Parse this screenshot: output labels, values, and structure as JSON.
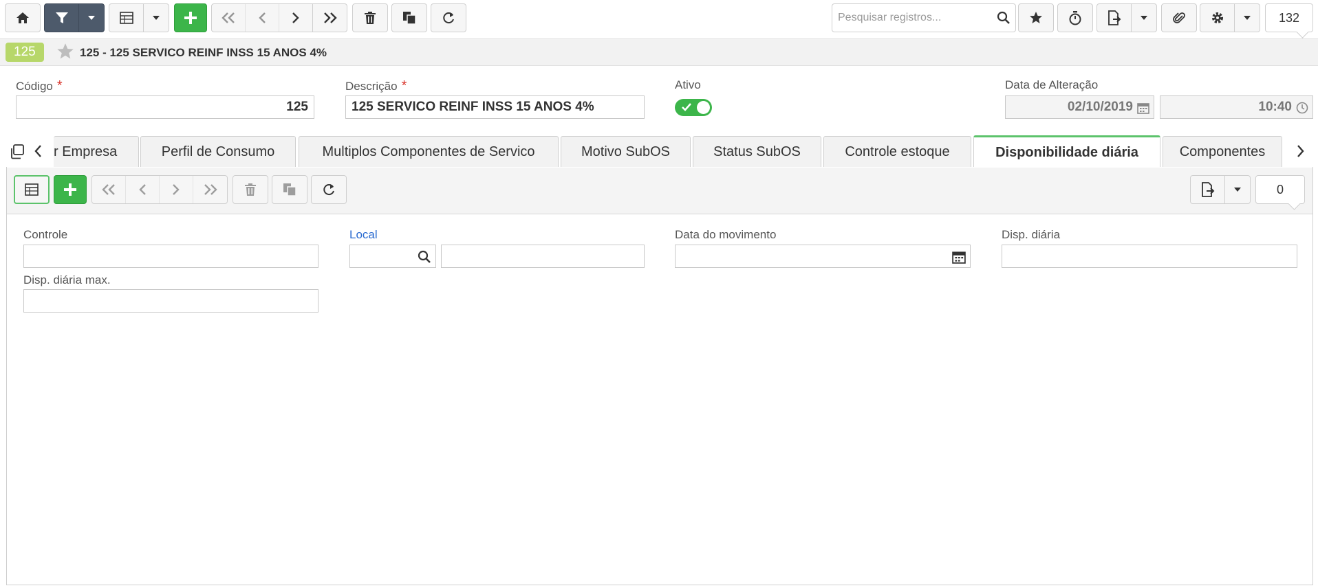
{
  "toolbar": {
    "search_placeholder": "Pesquisar registros...",
    "record_count": "132"
  },
  "record": {
    "badge": "125",
    "title": "125 - 125 SERVICO REINF INSS 15 ANOS 4%"
  },
  "form": {
    "codigo_label": "Código",
    "codigo_value": "125",
    "descricao_label": "Descrição",
    "descricao_value": "125 SERVICO REINF INSS 15 ANOS 4%",
    "ativo_label": "Ativo",
    "ativo_on": true,
    "data_alteracao_label": "Data de Alteração",
    "data_alteracao_date": "02/10/2019",
    "data_alteracao_time": "10:40",
    "required_mark": "*"
  },
  "tabs": [
    {
      "label": "r Empresa"
    },
    {
      "label": "Perfil de Consumo"
    },
    {
      "label": "Multiplos Componentes de Servico"
    },
    {
      "label": "Motivo SubOS"
    },
    {
      "label": "Status SubOS"
    },
    {
      "label": "Controle estoque"
    },
    {
      "label": "Disponibilidade diária",
      "active": true
    },
    {
      "label": "Componentes"
    }
  ],
  "detail": {
    "record_count": "0",
    "controle_label": "Controle",
    "local_label": "Local",
    "data_movimento_label": "Data do movimento",
    "disp_diaria_label": "Disp. diária",
    "disp_diaria_max_label": "Disp. diária max."
  },
  "colors": {
    "accent_green": "#3cb54a",
    "badge_green": "#b7d76a",
    "filter_dark": "#4d5a6b",
    "link_blue": "#2a6bd0",
    "required_red": "#d9342b"
  }
}
